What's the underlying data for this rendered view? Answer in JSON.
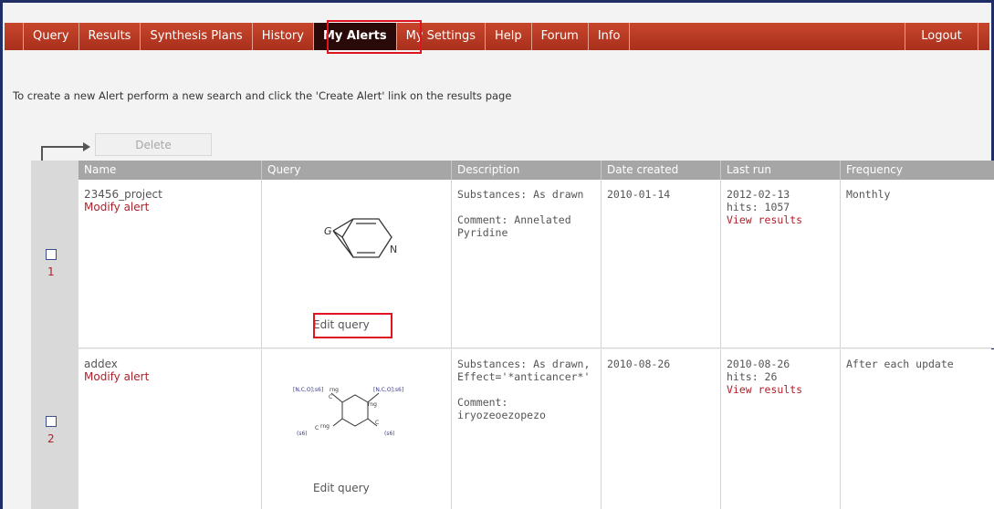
{
  "nav": {
    "items": [
      {
        "label": "Query"
      },
      {
        "label": "Results"
      },
      {
        "label": "Synthesis Plans"
      },
      {
        "label": "History"
      },
      {
        "label": "My Alerts"
      },
      {
        "label": "My Settings"
      },
      {
        "label": "Help"
      },
      {
        "label": "Forum"
      },
      {
        "label": "Info"
      }
    ],
    "logout": "Logout",
    "active": "My Alerts"
  },
  "info_text": "To create a new Alert perform a new search and click the 'Create Alert' link on the results page",
  "delete_label": "Delete",
  "table": {
    "headers": [
      "Name",
      "Query",
      "Description",
      "Date created",
      "Last run",
      "Frequency"
    ],
    "rows": [
      {
        "number": "1",
        "name": "23456_project",
        "modify": "Modify alert",
        "description_line1": "Substances: As drawn",
        "comment_label": "Comment: Annelated",
        "comment_value": "Pyridine",
        "date_created": "2010-01-14",
        "last_run": "2012-02-13",
        "hits": "hits: 1057",
        "view_results": "View results",
        "frequency": "Monthly",
        "edit_query": "Edit query",
        "structure_labels": {
          "g": "G",
          "n": "N"
        }
      },
      {
        "number": "2",
        "name": "addex",
        "modify": "Modify alert",
        "description_line1": "Substances: As drawn,",
        "description_line2": "Effect='*anticancer*'",
        "comment_label": "Comment:",
        "comment_value": "iryozeoezopezo",
        "date_created": "2010-08-26",
        "last_run": "2010-08-26",
        "hits": "hits: 26",
        "view_results": "View results",
        "frequency": "After each update",
        "edit_query": "Edit query",
        "structure_labels": {
          "tl": "[N,C,O];s6]",
          "tl_ring": "rng",
          "tr": "[N,C,O];s6]",
          "r_ring": "rng",
          "l_ring": "rng",
          "bl": "(s6)",
          "br": "(s6)",
          "c1": "C",
          "c2": "C",
          "c3": "C"
        }
      }
    ]
  },
  "colors": {
    "nav": "#b83a24",
    "active_tab": "#2a0a08",
    "link": "#b0202a",
    "highlight": "#e0141e"
  }
}
